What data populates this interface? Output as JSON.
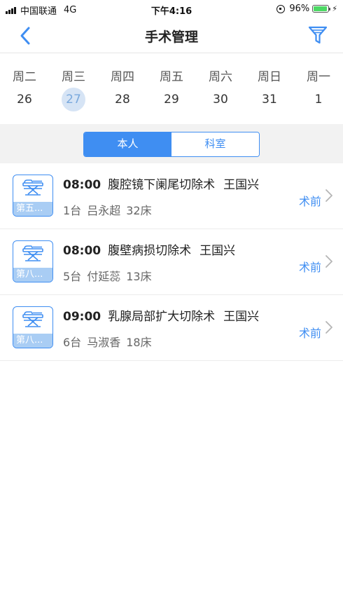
{
  "status_bar": {
    "carrier": "中国联通",
    "network": "4G",
    "time": "下午4:16",
    "battery": "96%",
    "battery_level": 0.96
  },
  "nav": {
    "title": "手术管理",
    "back_icon": "chevron-left-icon",
    "filter_icon": "filter-icon"
  },
  "week": [
    {
      "name": "周二",
      "num": "26",
      "selected": false
    },
    {
      "name": "周三",
      "num": "27",
      "selected": true
    },
    {
      "name": "周四",
      "num": "28",
      "selected": false
    },
    {
      "name": "周五",
      "num": "29",
      "selected": false
    },
    {
      "name": "周六",
      "num": "30",
      "selected": false
    },
    {
      "name": "周日",
      "num": "31",
      "selected": false
    },
    {
      "name": "周一",
      "num": "1",
      "selected": false
    }
  ],
  "segment": {
    "personal": "本人",
    "department": "科室",
    "active": "personal"
  },
  "surgeries": [
    {
      "room": "第五...",
      "time": "08:00",
      "procedure": "腹腔镜下阑尾切除术",
      "surgeon": "王国兴",
      "table": "1台",
      "patient": "吕永超",
      "bed": "32床",
      "status": "术前"
    },
    {
      "room": "第八...",
      "time": "08:00",
      "procedure": "腹壁病损切除术",
      "surgeon": "王国兴",
      "table": "5台",
      "patient": "付延蕊",
      "bed": "13床",
      "status": "术前"
    },
    {
      "room": "第八...",
      "time": "09:00",
      "procedure": "乳腺局部扩大切除术",
      "surgeon": "王国兴",
      "table": "6台",
      "patient": "马淑香",
      "bed": "18床",
      "status": "术前"
    }
  ],
  "colors": {
    "accent": "#3f8ef2",
    "selected_day_bg": "#d6e4f5",
    "badge_label_bg": "#a9cdf4"
  }
}
